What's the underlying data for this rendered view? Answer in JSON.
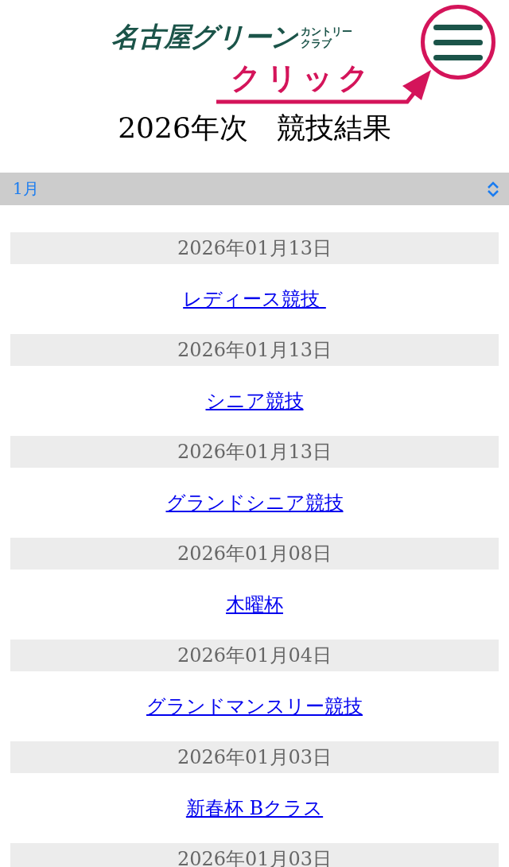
{
  "header": {
    "logo": {
      "main": "名古屋グリーン",
      "sub_top": "カントリー",
      "sub_bottom": "クラブ"
    },
    "annotation": "クリック"
  },
  "title": "2026年次　競技結果",
  "month_select": {
    "value": "1月"
  },
  "results": [
    {
      "date": "2026年01月13日",
      "title": "レディース競技 "
    },
    {
      "date": "2026年01月13日",
      "title": "シニア競技"
    },
    {
      "date": "2026年01月13日",
      "title": "グランドシニア競技"
    },
    {
      "date": "2026年01月08日",
      "title": "木曜杯"
    },
    {
      "date": "2026年01月04日",
      "title": "グランドマンスリー競技"
    },
    {
      "date": "2026年01月03日",
      "title": "新春杯 Bクラス"
    },
    {
      "date": "2026年01月03日"
    }
  ]
}
